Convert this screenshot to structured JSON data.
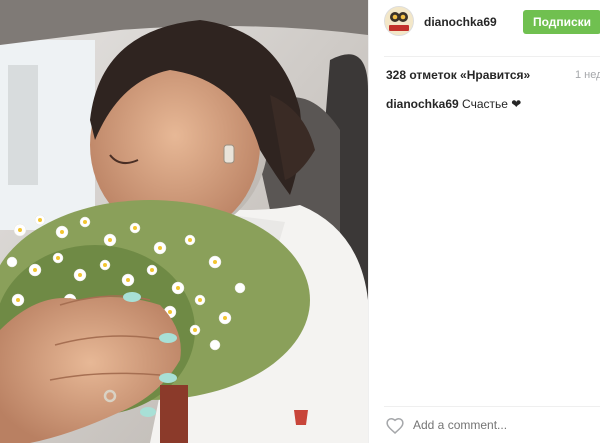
{
  "post": {
    "username": "dianochka69",
    "follow_label": "Подписки",
    "likes_text": "328 отметок «Нравится»",
    "time_text": "1 нед",
    "caption_username": "dianochka69",
    "caption_text": "Счастье ❤",
    "comment_placeholder": "Add a comment...",
    "avatar_text": "ЛУЧШАЯ АКТРИСА"
  },
  "colors": {
    "follow_button": "#70c050",
    "text": "#262626",
    "muted": "#a5a7aa",
    "divider": "#efefef"
  }
}
